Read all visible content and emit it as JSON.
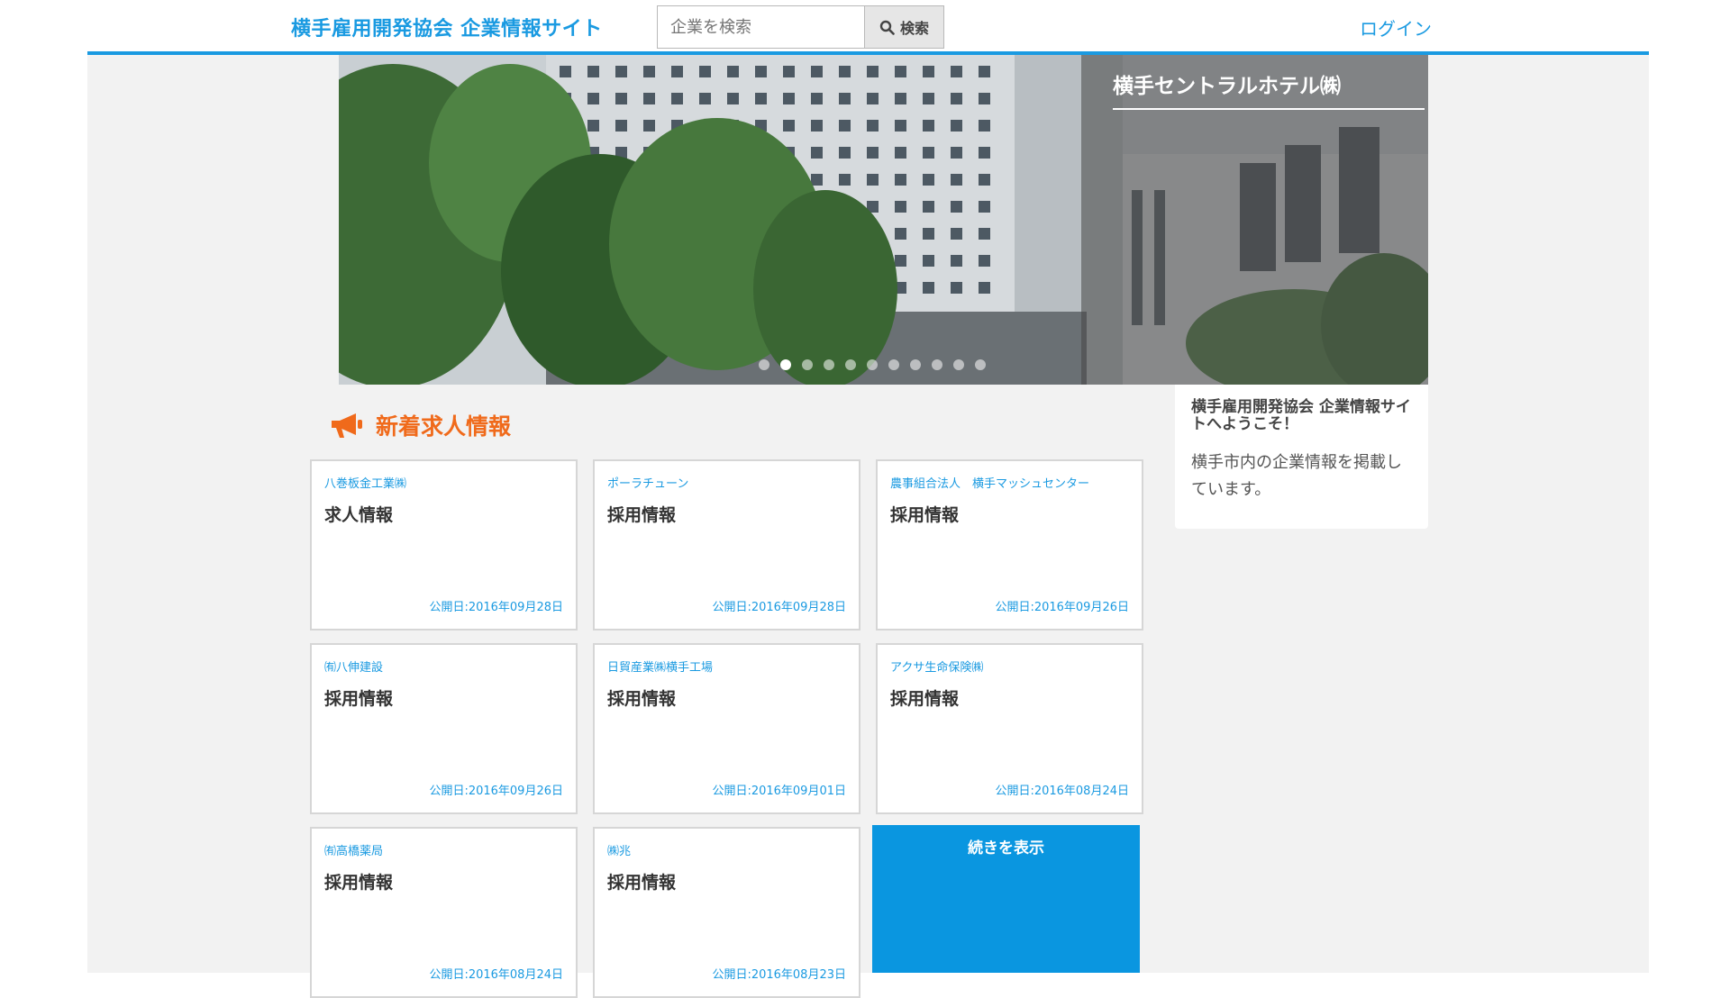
{
  "header": {
    "site_title": "横手雇用開発協会 企業情報サイト",
    "search_placeholder": "企業を検索",
    "search_button_label": "検索",
    "login_label": "ログイン",
    "accent_color": "#1a9ae1"
  },
  "hero": {
    "company_name": "横手セントラルホテル㈱",
    "slide_count": 11,
    "active_slide_index": 1
  },
  "jobs": {
    "section_title": "新着求人情報",
    "section_color": "#f06a1b",
    "cards": [
      {
        "company": "八巻板金工業㈱",
        "title": "求人情報",
        "date": "公開日:2016年09月28日"
      },
      {
        "company": "ポーラチューン",
        "title": "採用情報",
        "date": "公開日:2016年09月28日"
      },
      {
        "company": "農事組合法人　横手マッシュセンター",
        "title": "採用情報",
        "date": "公開日:2016年09月26日"
      },
      {
        "company": "㈲八伸建設",
        "title": "採用情報",
        "date": "公開日:2016年09月26日"
      },
      {
        "company": "日貿産業㈱横手工場",
        "title": "採用情報",
        "date": "公開日:2016年09月01日"
      },
      {
        "company": "アクサ生命保険㈱",
        "title": "採用情報",
        "date": "公開日:2016年08月24日"
      },
      {
        "company": "㈲高橋薬局",
        "title": "採用情報",
        "date": "公開日:2016年08月24日"
      },
      {
        "company": "㈱兆",
        "title": "採用情報",
        "date": "公開日:2016年08月23日"
      }
    ],
    "more_label": "続きを表示"
  },
  "welcome": {
    "title": "横手雇用開発協会 企業情報サイトへようこそ！",
    "body": "横手市内の企業情報を掲載しています。"
  }
}
